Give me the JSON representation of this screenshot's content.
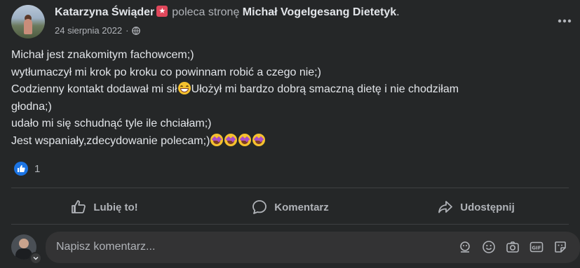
{
  "post": {
    "author": "Katarzyna Świąder",
    "action": "poleca stronę",
    "page_name": "Michał Vogelgesang Dietetyk",
    "punct": ".",
    "date": "24 sierpnia 2022",
    "dot": "·",
    "lines": {
      "l1": "Michał jest znakomitym fachowcem;)",
      "l2": "wytłumaczył mi krok po kroku co powinnam robić a czego nie;)",
      "l3a": "Codzienny kontakt dodawał mi sił",
      "l3b": "Ułożył mi bardzo dobrą smaczną dietę i nie chodziłam",
      "l4": "głodna;)",
      "l5": "udało mi się schudnąć tyle ile chciałam;)",
      "l6": "Jest wspaniały,zdecydowanie polecam;)"
    },
    "reaction_count": "1"
  },
  "actions": {
    "like": "Lubię to!",
    "comment": "Komentarz",
    "share": "Udostępnij"
  },
  "comment_box": {
    "placeholder": "Napisz komentarz..."
  },
  "colors": {
    "bg": "#252728",
    "accent": "#1b74e4",
    "badge": "#e0475b"
  },
  "icons": [
    "globe-icon",
    "more-options-icon",
    "like-reaction-icon",
    "thumb-up-icon",
    "comment-bubble-icon",
    "share-arrow-icon",
    "avatar-icon",
    "sticker-avatar-icon",
    "emoji-icon",
    "camera-icon",
    "gif-icon",
    "sticker-icon"
  ]
}
